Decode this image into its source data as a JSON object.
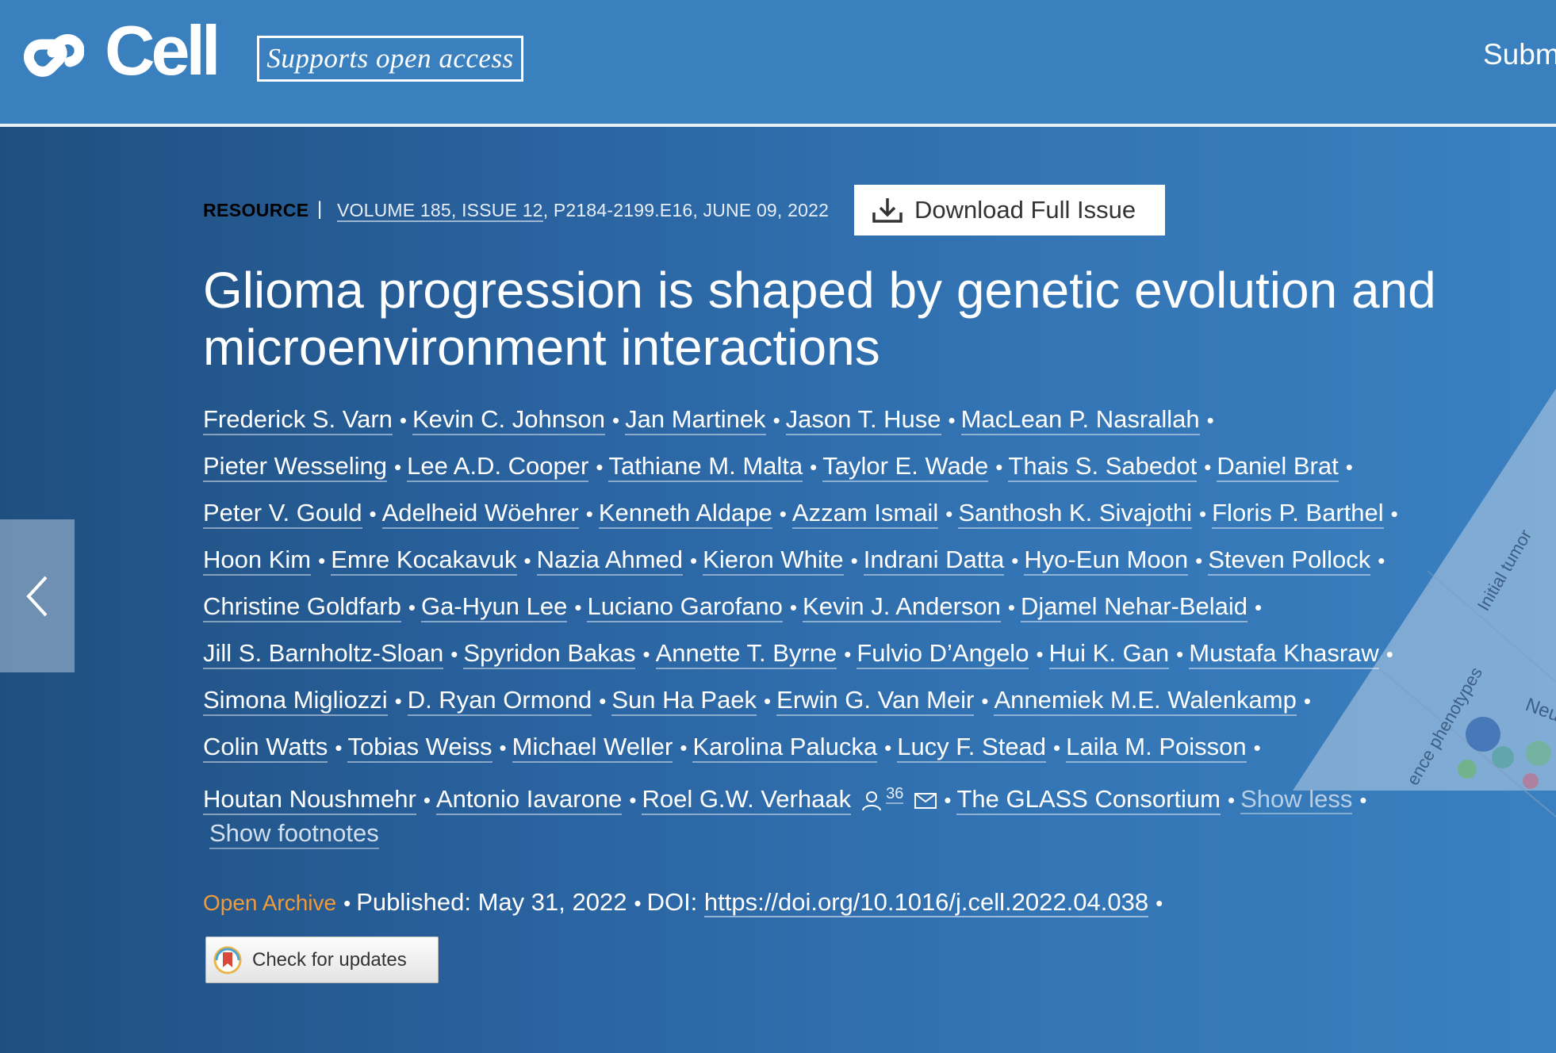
{
  "header": {
    "logo_text": "Cell",
    "badge_text": "Supports open access",
    "nav_submit": "Subm"
  },
  "article": {
    "type": "RESOURCE",
    "separator": "|",
    "volume_issue": "VOLUME 185, ISSUE 12",
    "pages_date": ", P2184-2199.E16, JUNE 09, 2022",
    "download_label": "Download Full Issue",
    "title_line1": "Glioma progression is shaped by genetic evolution and",
    "title_line2": "microenvironment interactions",
    "authors": [
      "Frederick S. Varn",
      "Kevin C. Johnson",
      "Jan Martinek",
      "Jason T. Huse",
      "MacLean P. Nasrallah",
      "Pieter Wesseling",
      "Lee A.D. Cooper",
      "Tathiane M. Malta",
      "Taylor E. Wade",
      "Thais S. Sabedot",
      "Daniel Brat",
      "Peter V. Gould",
      "Adelheid Wöehrer",
      "Kenneth Aldape",
      "Azzam Ismail",
      "Santhosh K. Sivajothi",
      "Floris P. Barthel",
      "Hoon Kim",
      "Emre Kocakavuk",
      "Nazia Ahmed",
      "Kieron White",
      "Indrani Datta",
      "Hyo-Eun Moon",
      "Steven Pollock",
      "Christine Goldfarb",
      "Ga-Hyun Lee",
      "Luciano Garofano",
      "Kevin J. Anderson",
      "Djamel Nehar-Belaid",
      "Jill S. Barnholtz-Sloan",
      "Spyridon Bakas",
      "Annette T. Byrne",
      "Fulvio D’Angelo",
      "Hui K. Gan",
      "Mustafa Khasraw",
      "Simona Migliozzi",
      "D. Ryan Ormond",
      "Sun Ha Paek",
      "Erwin G. Van Meir",
      "Annemiek M.E. Walenkamp",
      "Colin Watts",
      "Tobias Weiss",
      "Michael Weller",
      "Karolina Palucka",
      "Lucy F. Stead",
      "Laila M. Poisson",
      "Houtan Noushmehr",
      "Antonio Iavarone",
      "Roel G.W. Verhaak"
    ],
    "verhaak_sup": "36",
    "consortium": "The GLASS Consortium",
    "show_less": "Show less",
    "show_footnotes": "Show footnotes",
    "open_archive": "Open Archive",
    "published": "Published: May 31, 2022",
    "doi_prefix": "DOI:",
    "doi_link": "https://doi.org/10.1016/j.cell.2022.04.038",
    "check_updates": "Check for updates"
  },
  "abstract_image_text": {
    "label1": "Initial tumor",
    "label2": "ence phenotypes",
    "label3": "Neu"
  },
  "colors": {
    "header_bg": "#3a80bf",
    "hero_bg_dark": "#1f4f7f",
    "hero_bg_light": "#3a80c0",
    "open_archive": "#f19a38",
    "download_btn_bg": "#ffffff"
  }
}
